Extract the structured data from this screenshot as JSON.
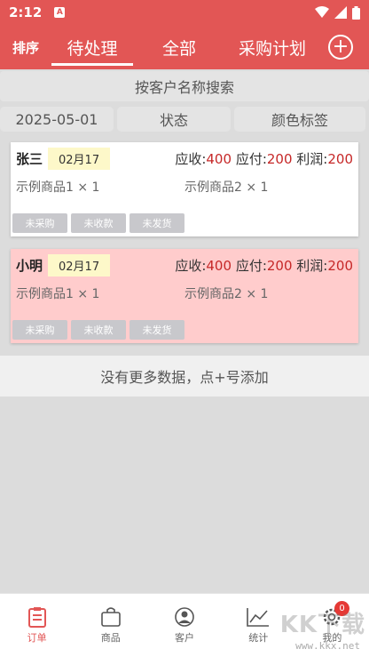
{
  "status_bar": {
    "time": "2:12",
    "notif": "A"
  },
  "header": {
    "sort_label": "排序",
    "tabs": [
      {
        "label": "待处理",
        "active": true
      },
      {
        "label": "全部",
        "active": false
      },
      {
        "label": "采购计划",
        "active": false
      }
    ],
    "add_symbol": "+"
  },
  "search": {
    "placeholder": "按客户名称搜索"
  },
  "filters": {
    "date": "2025-05-01",
    "status": "状态",
    "color": "颜色标签"
  },
  "orders": [
    {
      "customer": "张三",
      "date": "02月17",
      "receivable_label": "应收:",
      "receivable": "400",
      "payable_label": "应付:",
      "payable": "200",
      "profit_label": "利润:",
      "profit": "200",
      "goods": [
        "示例商品1 × 1",
        "示例商品2 × 1"
      ],
      "tags": [
        "未采购",
        "未收款",
        "未发货"
      ],
      "color": "#ffffff"
    },
    {
      "customer": "小明",
      "date": "02月17",
      "receivable_label": "应收:",
      "receivable": "400",
      "payable_label": "应付:",
      "payable": "200",
      "profit_label": "利润:",
      "profit": "200",
      "goods": [
        "示例商品1 × 1",
        "示例商品2 × 1"
      ],
      "tags": [
        "未采购",
        "未收款",
        "未发货"
      ],
      "color": "#ffcccc"
    }
  ],
  "no_more_text": "没有更多数据，点+号添加",
  "bottom_nav": [
    {
      "label": "订单",
      "icon": "clipboard-icon",
      "active": true
    },
    {
      "label": "商品",
      "icon": "bag-icon",
      "active": false
    },
    {
      "label": "客户",
      "icon": "person-icon",
      "active": false
    },
    {
      "label": "统计",
      "icon": "chart-icon",
      "active": false
    },
    {
      "label": "我的",
      "icon": "gear-icon",
      "active": false,
      "badge": "0"
    }
  ],
  "watermark": {
    "text": "KK下载",
    "url": "www.kkx.net"
  },
  "colors": {
    "primary": "#e25655",
    "accent_value": "#c62828",
    "date_tag": "#fdf8c9"
  }
}
